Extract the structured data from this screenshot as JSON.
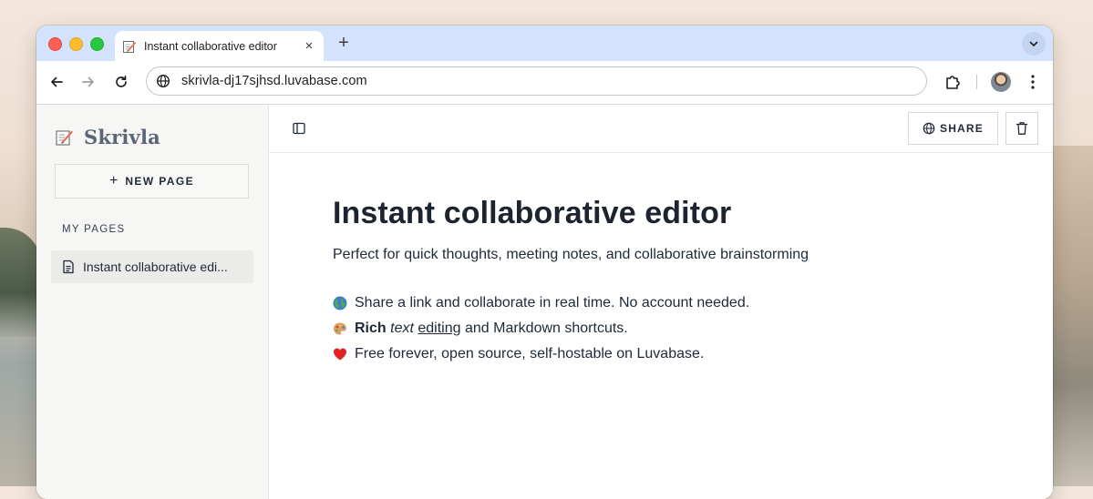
{
  "browser": {
    "tab": {
      "title": "Instant collaborative editor",
      "close_icon": "×",
      "favicon": "note-icon"
    },
    "newtab_icon": "+",
    "address": "skrivla-dj17sjhsd.luvabase.com",
    "colors": {
      "tabstrip": "#d3e3fd",
      "accent": "#fe5f57"
    }
  },
  "sidebar": {
    "brand": "Skrivla",
    "new_page_plus": "+",
    "new_page_label": "NEW PAGE",
    "my_pages_label": "MY PAGES",
    "pages": [
      {
        "label": "Instant collaborative edi..."
      }
    ]
  },
  "main_toolbar": {
    "share_label": "SHARE"
  },
  "document": {
    "title": "Instant collaborative editor",
    "subtitle": "Perfect for quick thoughts, meeting notes, and collaborative brainstorming",
    "line1": {
      "emoji": "globe-icon",
      "text": "Share a link and collaborate in real time. No account needed."
    },
    "line2": {
      "emoji": "palette-icon",
      "bold": "Rich",
      "italic": "text",
      "underline": "editing",
      "rest": "and Markdown shortcuts."
    },
    "line3": {
      "emoji": "heart-icon",
      "text": "Free forever, open source, self-hostable on Luvabase."
    }
  }
}
